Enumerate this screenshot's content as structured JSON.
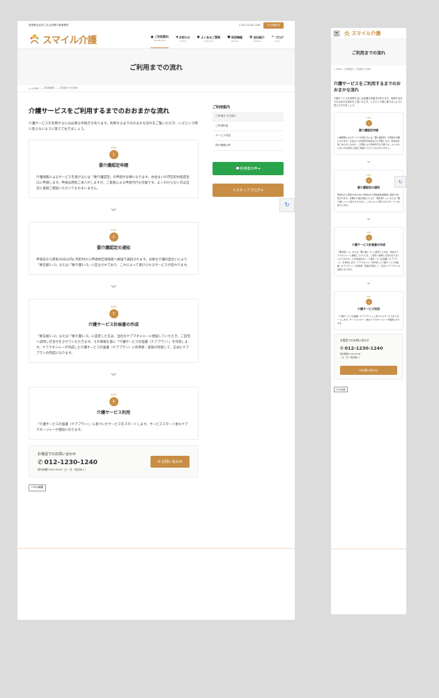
{
  "colors": {
    "brand": "#c98e45",
    "green": "#2aa44a"
  },
  "topbar": {
    "tagline": "宮城県仙台市にある訪問介護事業所",
    "phone": "012-1230-1240",
    "contact_btn": "お問合せ"
  },
  "logo": {
    "text": "スマイル介護",
    "icon": "smile-person-icon"
  },
  "nav": [
    {
      "label": "ご利用案内",
      "sub": "INFORMATION",
      "icon": "info-circle-icon",
      "active": true
    },
    {
      "label": "お知らせ",
      "sub": "NOTICE",
      "icon": "megaphone-icon",
      "active": false
    },
    {
      "label": "よくあるご質問",
      "sub": "QUESTION",
      "icon": "question-circle-icon",
      "active": false
    },
    {
      "label": "採用情報",
      "sub": "RECRUIT",
      "icon": "briefcase-icon",
      "active": false
    },
    {
      "label": "会社紹介",
      "sub": "COMPANY",
      "icon": "building-icon",
      "active": false
    },
    {
      "label": "ブログ",
      "sub": "BLOG",
      "icon": "pencil-icon",
      "active": false
    }
  ],
  "page_title": "ご利用までの流れ",
  "breadcrumb": {
    "home": "HOME",
    "sep": "/",
    "parent": "ご利用案内",
    "current": "ご利用までの流れ"
  },
  "main": {
    "heading": "介護サービスをご利用するまでのおおまかな流れ",
    "lead": "介護サービスを利用するには必要な手続きがあります。利用するまでの大まかな流れをご覧いただき、いざという時に焦らないように覚えておきましょう。",
    "step_label": "STEP",
    "steps": [
      {
        "num": "1",
        "title": "要介護認定申請",
        "body": "介護保険によるサービスを受けるには「要介護認定」の申請が必要になります。お住まいの市区町村指定窓口に申請します。申請は原則ご本人がしますが、ご家族による申請代行も可能です。よくわからない方は当社に直接ご相談いただいてもかまいません。"
      },
      {
        "num": "2",
        "title": "要介護認定の通知",
        "body": "申請日から原則30日以内に市町村から申請地区保険者へ郵送で通知されます。必要な介護の度合いにより「要支援1~2」または「要介護1~5」に区分されており、これによって受けられるサービスが変わります。"
      },
      {
        "num": "3",
        "title": "介護サービス計画書の作成",
        "body": "「要支援1~2」または「要介護1~5」に認定した方は、当社のケアマネジャーに相談していただき、ご自宅へ訪問し打合せをさせていただきます。その情報を基に「介護サービス計画書（ケアプラン）」を作成します。ケアマネジャーが作成した介護サービス計画書（ケアプラン）に利用者・家族が同意して、正式にケアプランの完成になります。"
      },
      {
        "num": "4",
        "title": "介護サービス利用",
        "body": "「介護サービス計画書（ケアプラン）」に基づいたサービスをスタートします。サービススタート後もケアマネージャーが相談にのります。"
      }
    ]
  },
  "cta": {
    "title": "お電話でのお問い合わせ",
    "phone": "012-1230-1240",
    "hours": "受付時間 9:00-18:00（土・日・祝日除く）",
    "hours_mobile_1": "受付時間 9:00-18:00",
    "hours_mobile_2": "（土・日・祝日除く）",
    "button": "お問い合わせ",
    "edit": "CTAの編集"
  },
  "sidebar": {
    "title": "ご利用案内",
    "items": [
      "ご利用までの流れ",
      "ご利用料金",
      "サービス内容",
      "同行援護の声"
    ],
    "voice_btn": "利用者の声",
    "blog_btn": "スタッフブログ"
  }
}
